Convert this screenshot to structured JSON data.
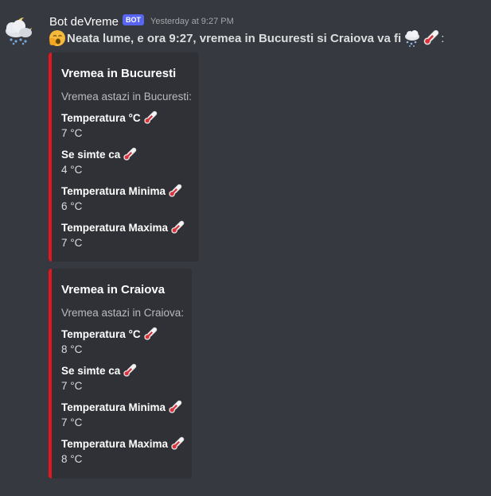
{
  "message": {
    "author": "Bot deVreme",
    "bot_tag": "BOT",
    "timestamp": "Yesterday at 9:27 PM",
    "content": "Neata lume, e ora 9:27, vremea in Bucuresti si Craiova va fi",
    "content_suffix": ":",
    "icons": {
      "avatar": "weather-cloud-moon-avatar",
      "greeting": "yawning-face-icon",
      "weather": "cloud-snow-icon",
      "temperature": "thermometer-icon"
    }
  },
  "embeds": [
    {
      "title": "Vremea in Bucuresti",
      "description": "Vremea astazi in Bucuresti:",
      "accent_color": "#e4161f",
      "fields": [
        {
          "name": "Temperatura °C",
          "value": "7 °C"
        },
        {
          "name": "Se simte ca",
          "value": "4 °C"
        },
        {
          "name": "Temperatura Minima",
          "value": "6 °C"
        },
        {
          "name": "Temperatura Maxima",
          "value": "7 °C"
        }
      ]
    },
    {
      "title": "Vremea in Craiova",
      "description": "Vremea astazi in Craiova:",
      "accent_color": "#e4161f",
      "fields": [
        {
          "name": "Temperatura °C",
          "value": "8 °C"
        },
        {
          "name": "Se simte ca",
          "value": "7 °C"
        },
        {
          "name": "Temperatura Minima",
          "value": "7 °C"
        },
        {
          "name": "Temperatura Maxima",
          "value": "8 °C"
        }
      ]
    }
  ]
}
